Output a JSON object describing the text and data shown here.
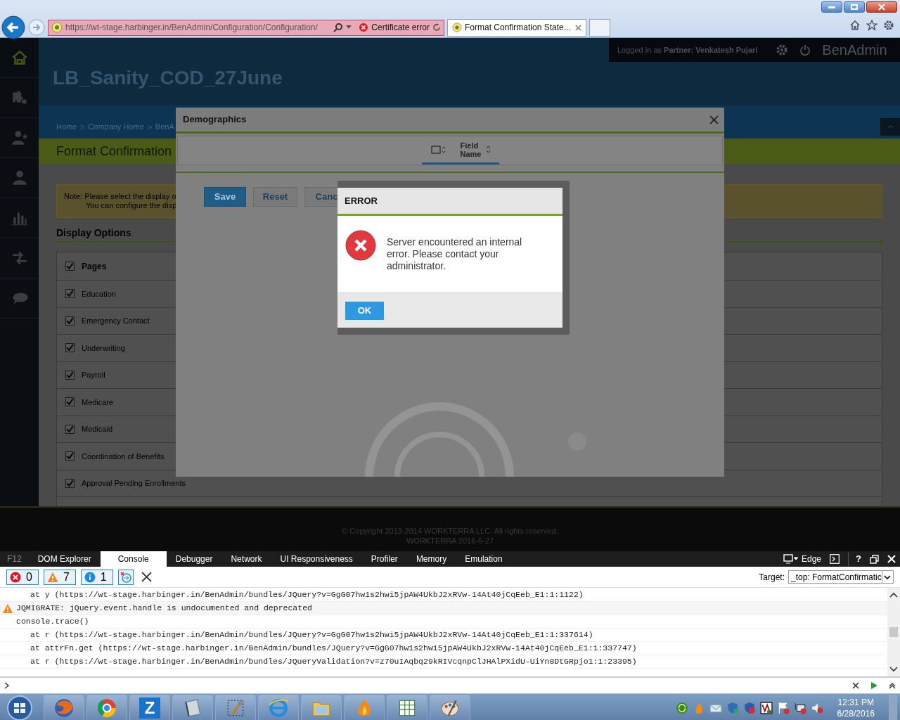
{
  "browser": {
    "address": "https://wt-stage.harbinger.in/BenAdmin/Configuration/Configuration/",
    "certificate": "Certificate error",
    "tabs": [
      {
        "title": "Format Confirmation State...",
        "selected": true
      }
    ]
  },
  "app": {
    "login": "Logged in as **Partner:  Venkatesh Pujari**",
    "brand": "BenAdmin",
    "company": "LB_Sanity_COD_27June",
    "breadcrumbs": [
      "Home",
      "Company Home",
      "BenA"
    ],
    "page_title": "Format Confirmation",
    "note": [
      "Note: Please select the display o",
      "You can configure the disp"
    ],
    "section": "Display Options",
    "pages": [
      {
        "label": "Pages",
        "checked": true,
        "kind": "header"
      },
      {
        "label": "Education",
        "checked": true,
        "kind": "item"
      },
      {
        "label": "Emergency Contact",
        "checked": true,
        "kind": "item"
      },
      {
        "label": "Underwriting",
        "checked": true,
        "kind": "item"
      },
      {
        "label": "Payroll",
        "checked": true,
        "kind": "item"
      },
      {
        "label": "Medicare",
        "checked": true,
        "kind": "item"
      },
      {
        "label": "Medicaid",
        "checked": true,
        "kind": "item"
      },
      {
        "label": "Coordination of Benefits",
        "checked": true,
        "kind": "item"
      },
      {
        "label": "Approval Pending Enrollments",
        "checked": true,
        "kind": "item"
      }
    ]
  },
  "modal": {
    "title": "Demographics",
    "column": "Field Name",
    "buttons": [
      {
        "label": "Save",
        "kind": "primary"
      },
      {
        "label": "Reset",
        "kind": "secondary"
      },
      {
        "label": "Canc",
        "kind": "secondary"
      }
    ]
  },
  "error": {
    "title": "ERROR",
    "message": "Server encountered an internal error. Please contact your administrator.",
    "button": "OK"
  },
  "footer": [
    "© Copyright 2013-2014 WORKTERRA LLC. All rights reserved.",
    "WORKTERRA 2016-6-27"
  ],
  "devtools": {
    "f12": "F12",
    "tabs": [
      {
        "label": "DOM Explorer",
        "selected": false
      },
      {
        "label": "Console",
        "selected": true
      },
      {
        "label": "Debugger",
        "selected": false
      },
      {
        "label": "Network",
        "selected": false
      },
      {
        "label": "UI Responsiveness",
        "selected": false
      },
      {
        "label": "Profiler",
        "selected": false
      },
      {
        "label": "Memory",
        "selected": false
      },
      {
        "label": "Emulation",
        "selected": false
      }
    ],
    "mode": "Edge",
    "help": "?",
    "counts": [
      {
        "kind": "error",
        "count": "0"
      },
      {
        "kind": "warning",
        "count": "7"
      },
      {
        "kind": "info",
        "count": "1"
      }
    ],
    "target_label": "Target:",
    "target": "_top: FormatConfirmatic",
    "lines": [
      {
        "kind": "trace",
        "text": "at y (https://wt-stage.harbinger.in/BenAdmin/bundles/JQuery?v=GgG07hw1s2hwi5jpAW4UkbJ2xRVw-14At40jCqEeb_E1:1:1122)"
      },
      {
        "kind": "warning",
        "text": "JQMIGRATE: jQuery.event.handle is undocumented and deprecated"
      },
      {
        "kind": "plain",
        "text": "console.trace()"
      },
      {
        "kind": "trace",
        "text": "at r (https://wt-stage.harbinger.in/BenAdmin/bundles/JQuery?v=GgG07hw1s2hwi5jpAW4UkbJ2xRVw-14At40jCqEeb_E1:1:337614)"
      },
      {
        "kind": "trace",
        "text": "at attrFn.get (https://wt-stage.harbinger.in/BenAdmin/bundles/JQuery?v=GgG07hw1s2hwi5jpAW4UkbJ2xRVw-14At40jCqEeb_E1:1:337747)"
      },
      {
        "kind": "trace",
        "text": "at r (https://wt-stage.harbinger.in/BenAdmin/bundles/JQueryValidation?v=z70uIAqbq29kRIVcqnpClJHAlPXidU-UiYn8DtGRpjo1:1:23395)"
      }
    ]
  },
  "taskbar": {
    "apps": [
      {
        "kind": "fox"
      },
      {
        "kind": "wheel"
      },
      {
        "kind": "letter",
        "label": "Z"
      },
      {
        "kind": "book"
      },
      {
        "kind": "tools"
      },
      {
        "kind": "globe"
      },
      {
        "kind": "folder"
      },
      {
        "kind": "flame"
      },
      {
        "kind": "sheet"
      },
      {
        "kind": "palette"
      }
    ],
    "time": "12:31 PM",
    "date": "6/28/2016"
  }
}
